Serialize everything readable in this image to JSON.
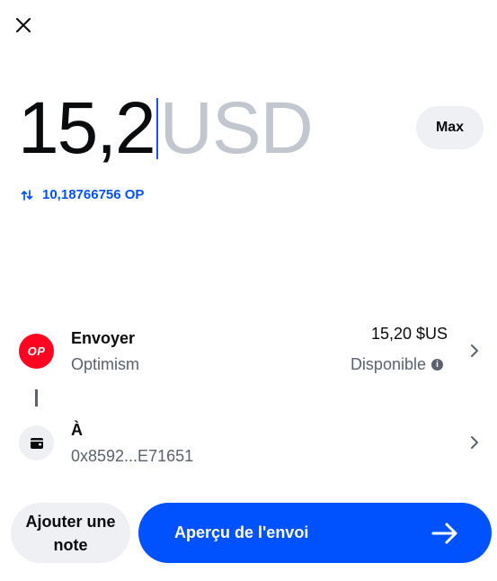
{
  "header": {
    "close_icon": "close-icon"
  },
  "amount": {
    "value": "15,2",
    "currency": "USD",
    "max_label": "Max",
    "conversion_icon": "swap-vertical-icon",
    "conversion_text": "10,18766756 OP"
  },
  "send": {
    "title": "Envoyer",
    "network": "Optimism",
    "logo_text": "OP",
    "amount": "15,20 $US",
    "available_label": "Disponible",
    "info_icon": "info-icon",
    "chevron_icon": "chevron-right-icon"
  },
  "recipient": {
    "title": "À",
    "address": "0x8592...E71651",
    "wallet_icon": "wallet-icon",
    "chevron_icon": "chevron-right-icon"
  },
  "footer": {
    "note_label": "Ajouter une note",
    "preview_label": "Aperçu de l'envoi",
    "arrow_icon": "arrow-right-icon"
  },
  "colors": {
    "accent": "#0052ff",
    "op_red": "#ff0420",
    "muted_text": "#5b616e",
    "placeholder": "#c1c6cf",
    "chip_bg": "#eef0f3"
  }
}
